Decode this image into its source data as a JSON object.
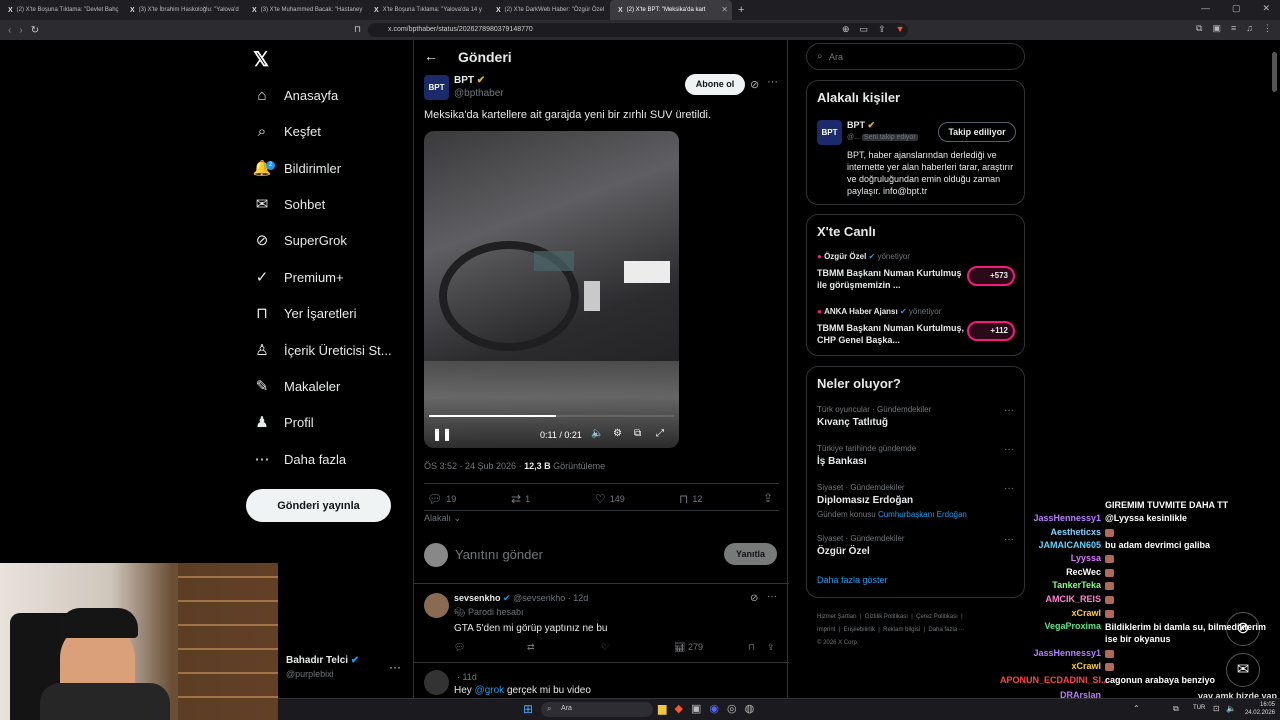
{
  "browser": {
    "tabs": [
      {
        "label": "(2) X'te Boşuna Tıklama: \"Devlet Bahç"
      },
      {
        "label": "(3) X'te İbrahim Haskoloğlu: \"Yalova'd"
      },
      {
        "label": "(3) X'te Muhammed Bacak: \"Hastaney"
      },
      {
        "label": "X'te Boşuna Tıklama: \"Yalova'da 14 y"
      },
      {
        "label": "(2) X'te DarkWeb Haber: \"Özgür Özel"
      },
      {
        "label": "(2) X'te BPT: \"Meksika'da kart"
      }
    ],
    "new_tab": "+",
    "url": "x.com/bpthaber/status/2026278980379148770"
  },
  "sidebar": {
    "items": [
      {
        "label": "Anasayfa",
        "icon": "home-icon",
        "glyph": "⌂"
      },
      {
        "label": "Keşfet",
        "icon": "search-icon",
        "glyph": "⌕"
      },
      {
        "label": "Bildirimler",
        "icon": "bell-icon",
        "glyph": "🔔",
        "badge": "2"
      },
      {
        "label": "Sohbet",
        "icon": "mail-icon",
        "glyph": "✉"
      },
      {
        "label": "SuperGrok",
        "icon": "grok-icon",
        "glyph": "⊘"
      },
      {
        "label": "Premium+",
        "icon": "premium-icon",
        "glyph": "✓"
      },
      {
        "label": "Yer İşaretleri",
        "icon": "bookmark-icon",
        "glyph": "⊓"
      },
      {
        "label": "İçerik Üreticisi St...",
        "icon": "studio-icon",
        "glyph": "♙"
      },
      {
        "label": "Makaleler",
        "icon": "article-icon",
        "glyph": "✎"
      },
      {
        "label": "Profil",
        "icon": "profile-icon",
        "glyph": "♟"
      },
      {
        "label": "Daha fazla",
        "icon": "more-icon",
        "glyph": "⋯"
      }
    ],
    "post_button": "Gönderi yayınla",
    "account": {
      "name": "Bahadır Telci",
      "handle": "@purplebixi"
    }
  },
  "header": {
    "title": "Gönderi"
  },
  "post": {
    "author": "BPT",
    "handle": "@bpthaber",
    "follow_label": "Abone ol",
    "text": "Meksika'da kartellere ait garajda yeni bir zırhlı SUV üretildi.",
    "video_time": "0:11 / 0:21",
    "video_progress": 0.52,
    "timestamp": "ÖS 3:52 · 24 Şub 2026 · ",
    "views": "12,3 B",
    "views_label": " Görüntüleme",
    "replies": "19",
    "reposts": "1",
    "likes": "149",
    "bookmarks": "12",
    "relevance": "Alakalı",
    "reply_placeholder": "Yanıtını gönder",
    "reply_button": "Yanıtla"
  },
  "replies": [
    {
      "name": "sevsenkho",
      "handle": "@sevsenkho · 12d",
      "tag": "Parodi hesabı",
      "text": "GTA 5'den mi görüp yaptınız ne bu",
      "views": "279"
    },
    {
      "time": "· 11d",
      "text_prefix": "Hey ",
      "mention": "@grok",
      "text_suffix": " gerçek mi bu video"
    }
  ],
  "search": {
    "placeholder": "Ara"
  },
  "related": {
    "title": "Alakalı kişiler",
    "name": "BPT",
    "handle": "@...",
    "follows_you": "Seni takip ediyor",
    "button": "Takip ediliyor",
    "bio": "BPT, haber ajanslarından derlediği ve internette yer alan haberleri tarar, araştırır ve doğruluğundan emin olduğu zaman paylaşır. info@bpt.tr"
  },
  "live": {
    "title": "X'te Canlı",
    "items": [
      {
        "host": "Özgür Özel",
        "role": "yönetiyor",
        "title": "TBMM Başkanı Numan Kurtulmuş ile görüşmemizin ...",
        "count": "+573"
      },
      {
        "host": "ANKA Haber Ajansı",
        "role": "yönetiyor",
        "title": "TBMM Başkanı Numan Kurtulmuş, CHP Genel Başka...",
        "count": "+112"
      }
    ]
  },
  "trends": {
    "title": "Neler oluyor?",
    "items": [
      {
        "cat": "Türk oyuncular · Gündemdekiler",
        "name": "Kıvanç Tatlıtuğ"
      },
      {
        "cat": "Türkiye tarihinde gündemde",
        "name": "İş Bankası"
      },
      {
        "cat": "Siyaset · Gündemdekiler",
        "name": "Diplomasız Erdoğan",
        "extra": "Gündem konusu ",
        "extra_link": "Cumhurbaşkanı Erdoğan"
      },
      {
        "cat": "Siyaset · Gündemdekiler",
        "name": "Özgür Özel"
      }
    ],
    "more": "Daha fazla göster"
  },
  "footer": {
    "links1": "Hizmet Şartları  |  Gizlilik Politikası  |  Çerez Politikası  |",
    "links2": "Imprint  |  Erişilebilirlik  |  Reklam bilgisi  |  Daha fazla ···",
    "copyright": "© 2026 X Corp."
  },
  "chat": [
    {
      "user": "",
      "msg": "GIREMIM TUVMITE DAHA TT",
      "color": "#ffffff"
    },
    {
      "user": "JassHennessy1",
      "msg": "@Lyyssa kesinlikle",
      "color": "#b77bff"
    },
    {
      "user": "Aestheticxs",
      "msg": "",
      "color": "#7fd4ff",
      "emote": true
    },
    {
      "user": "JAMAICAN605",
      "msg": "bu adam devrimci galiba",
      "color": "#5fd6ff"
    },
    {
      "user": "Lyyssa",
      "msg": "",
      "color": "#d87aff",
      "emote": true
    },
    {
      "user": "RecWec",
      "msg": "",
      "color": "#ffffff",
      "emote": true
    },
    {
      "user": "TankerTeka",
      "msg": "",
      "color": "#7fff7f",
      "emote": true
    },
    {
      "user": "AMCIK_REIS",
      "msg": "",
      "color": "#ff7fd4",
      "emote": true
    },
    {
      "user": "xCrawl",
      "msg": "",
      "color": "#ffcc33",
      "emote": true
    },
    {
      "user": "VegaProxima",
      "msg": "Bildiklerim bi damla su, bilmediklerim ise bir okyanus",
      "color": "#57e389"
    },
    {
      "user": "JassHennessy1",
      "msg": "",
      "color": "#b77bff",
      "emote": true
    },
    {
      "user": "xCrawl",
      "msg": "",
      "color": "#ffcc33",
      "emote": true
    },
    {
      "user": "APONUN_ECDADINI_SI...",
      "msg": "cagonun arabaya benziyo",
      "color": "#ff4444"
    },
    {
      "user": "DRArslan",
      "msg": "",
      "color": "#b77bff"
    }
  ],
  "overlay_text": "vay amk bizde yap",
  "taskbar": {
    "search": "Ara",
    "lang": "TUR",
    "time": "16:05",
    "date": "24.02.2026"
  },
  "colors": {
    "accent": "#1d9bf0",
    "brand": "#e7e9ea",
    "live": "#f91880"
  }
}
